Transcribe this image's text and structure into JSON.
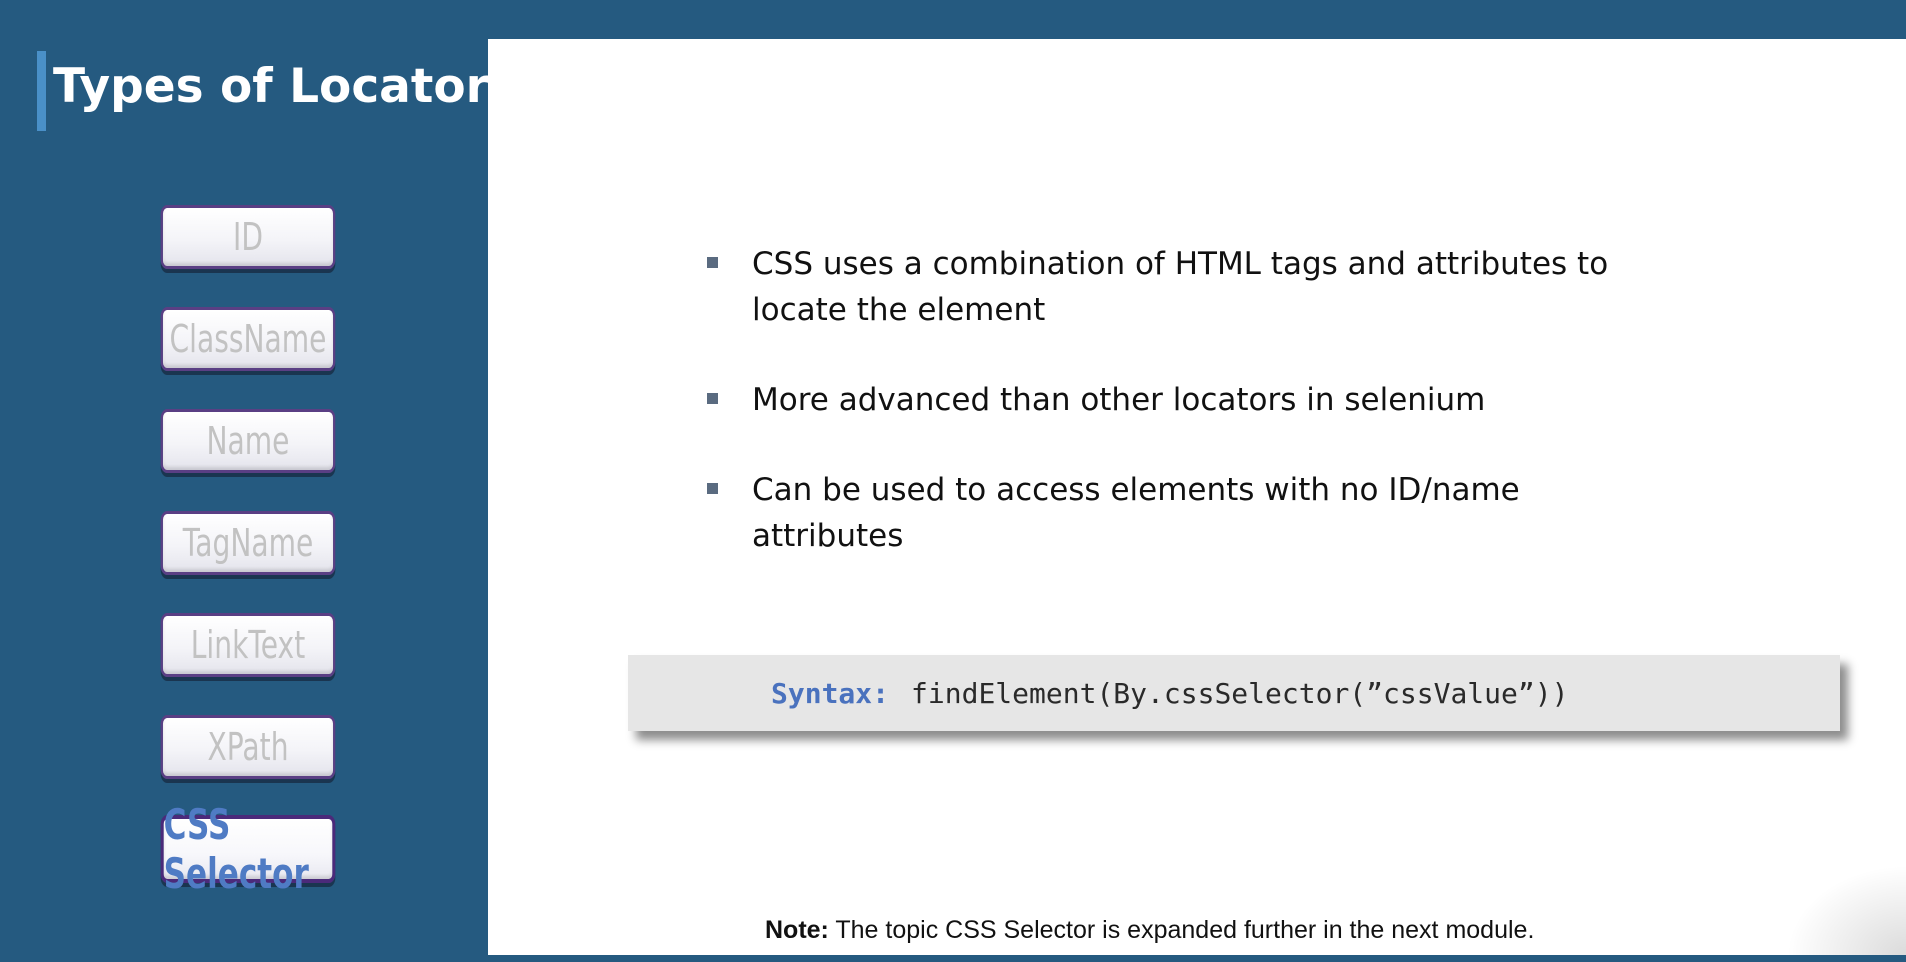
{
  "slide": {
    "title": "Types of Locators"
  },
  "locators": [
    {
      "label": "ID",
      "active": false
    },
    {
      "label": "ClassName",
      "active": false
    },
    {
      "label": "Name",
      "active": false
    },
    {
      "label": "TagName",
      "active": false
    },
    {
      "label": "LinkText",
      "active": false
    },
    {
      "label": "XPath",
      "active": false
    },
    {
      "label": "CSS Selector",
      "active": true
    }
  ],
  "content": {
    "bullets": [
      "CSS uses a combination of HTML tags and attributes to locate the element",
      "More advanced than other locators in selenium",
      "Can be used to access elements with no ID/name attributes"
    ],
    "syntax": {
      "label": "Syntax:",
      "code": "findElement(By.cssSelector(”cssValue”))"
    },
    "note": {
      "label": "Note:",
      "text": " The topic CSS Selector is expanded further in the next module."
    }
  },
  "colors": {
    "background": "#255a80",
    "accent_bar": "#4a90c8",
    "active_locator_text": "#4f7bc4",
    "inactive_locator_text": "#c2c2c2",
    "button_border": "#5a3f84",
    "syntax_label": "#4a72be",
    "syntax_box": "#e6e6e6"
  }
}
